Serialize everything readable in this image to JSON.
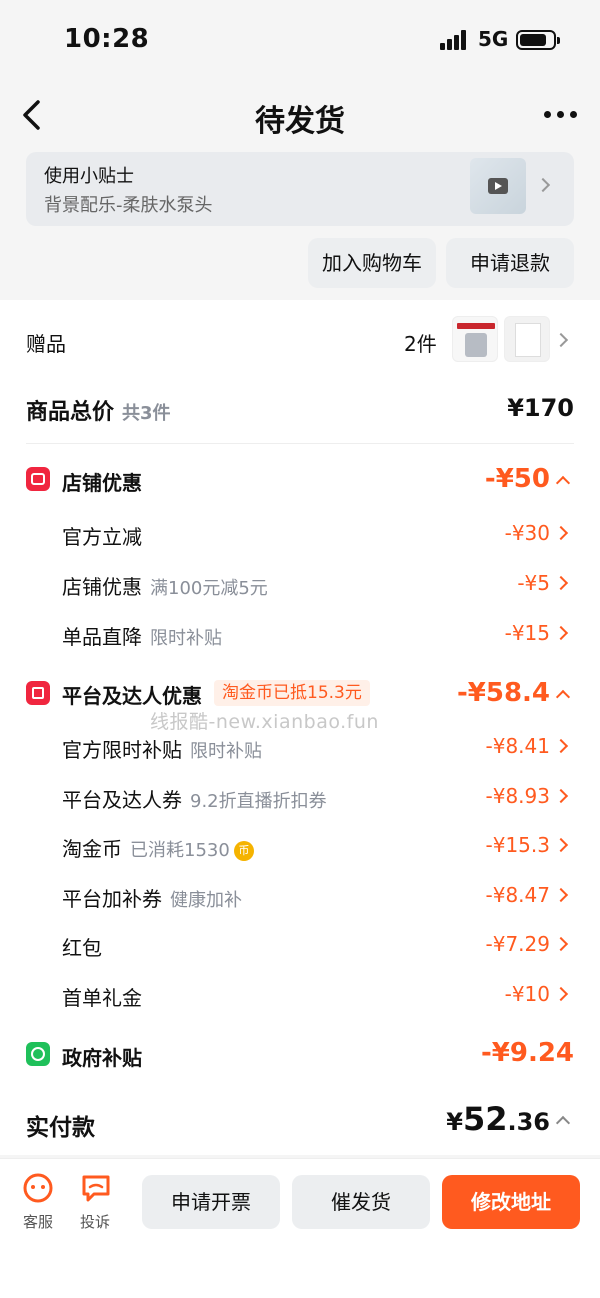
{
  "status": {
    "time": "10:28",
    "network": "5G"
  },
  "nav": {
    "title": "待发货"
  },
  "tip": {
    "title": "使用小贴士",
    "subtitle": "背景配乐-柔肤水泵头"
  },
  "actions": {
    "add_cart": "加入购物车",
    "refund": "申请退款"
  },
  "gift": {
    "label": "赠品",
    "count": "2件"
  },
  "total": {
    "label": "商品总价",
    "count": "共3件",
    "value": "¥170"
  },
  "store_discount": {
    "title": "店铺优惠",
    "value": "-¥50",
    "items": [
      {
        "label": "官方立减",
        "sub": "",
        "value": "-¥30"
      },
      {
        "label": "店铺优惠",
        "sub": "满100元减5元",
        "value": "-¥5"
      },
      {
        "label": "单品直降",
        "sub": "限时补贴",
        "value": "-¥15"
      }
    ]
  },
  "platform_discount": {
    "title": "平台及达人优惠",
    "badge": "淘金币已抵15.3元",
    "value": "-¥58.4",
    "items": [
      {
        "label": "官方限时补贴",
        "sub": "限时补贴",
        "value": "-¥8.41"
      },
      {
        "label": "平台及达人券",
        "sub": "9.2折直播折扣券",
        "value": "-¥8.93"
      },
      {
        "label": "淘金币",
        "sub": "已消耗1530",
        "value": "-¥15.3"
      },
      {
        "label": "平台加补券",
        "sub": "健康加补",
        "value": "-¥8.47"
      },
      {
        "label": "红包",
        "sub": "",
        "value": "-¥7.29"
      },
      {
        "label": "首单礼金",
        "sub": "",
        "value": "-¥10"
      }
    ]
  },
  "watermark": "线报酷-new.xianbao.fun",
  "gov_subsidy": {
    "title": "政府补贴",
    "value": "-¥9.24"
  },
  "paid": {
    "label": "实付款",
    "currency": "¥",
    "integer": "52",
    "decimal": ".36"
  },
  "bottom": {
    "service": "客服",
    "complaint": "投诉",
    "invoice": "申请开票",
    "urge": "催发货",
    "change_address": "修改地址"
  },
  "colors": {
    "accent": "#ff5a1f",
    "store_icon": "#f0263f",
    "gov_icon": "#1fc05a"
  }
}
